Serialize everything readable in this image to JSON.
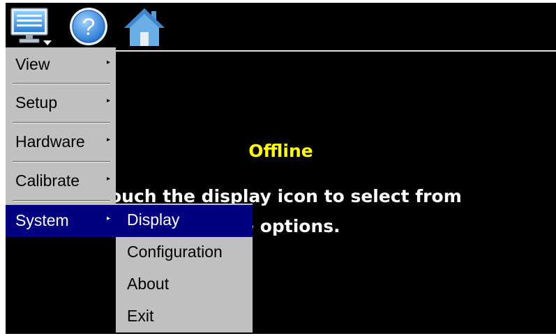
{
  "toolbar": {
    "icons": [
      "monitor-display-icon",
      "help-question-icon",
      "home-icon"
    ]
  },
  "status": {
    "title": "Offline",
    "instruction_line1": "Touch the display icon to select from",
    "instruction_line2": "the options.",
    "title_color": "#ffff00"
  },
  "main_menu": {
    "items": [
      {
        "label": "View",
        "has_submenu": true
      },
      {
        "label": "Setup",
        "has_submenu": true
      },
      {
        "label": "Hardware",
        "has_submenu": true
      },
      {
        "label": "Calibrate",
        "has_submenu": true
      },
      {
        "label": "System",
        "has_submenu": true,
        "selected": true
      }
    ],
    "submenu_arrow": "▸"
  },
  "system_submenu": {
    "items": [
      {
        "label": "Display",
        "selected": true
      },
      {
        "label": "Configuration"
      },
      {
        "label": "About"
      },
      {
        "label": "Exit"
      }
    ]
  },
  "colors": {
    "menu_bg": "#c0c0c0",
    "selection_bg": "#000080",
    "screen_bg": "#000000"
  }
}
